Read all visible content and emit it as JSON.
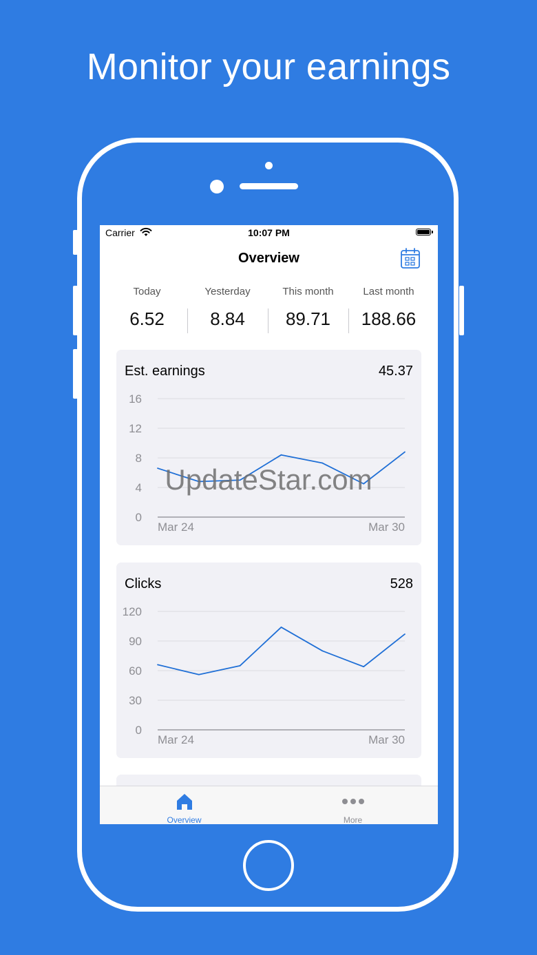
{
  "headline": "Monitor your earnings",
  "status_bar": {
    "carrier": "Carrier",
    "time": "10:07 PM"
  },
  "nav": {
    "title": "Overview"
  },
  "stats": [
    {
      "label": "Today",
      "value": "6.52"
    },
    {
      "label": "Yesterday",
      "value": "8.84"
    },
    {
      "label": "This month",
      "value": "89.71"
    },
    {
      "label": "Last month",
      "value": "188.66"
    }
  ],
  "cards": [
    {
      "title": "Est. earnings",
      "total": "45.37"
    },
    {
      "title": "Clicks",
      "total": "528"
    }
  ],
  "tabs": [
    {
      "label": "Overview",
      "icon": "house-icon",
      "active": true
    },
    {
      "label": "More",
      "icon": "ellipsis-icon",
      "active": false
    }
  ],
  "watermark": "UpdateStar.com",
  "colors": {
    "background": "#2f7ce2",
    "accent": "#2f7ce2",
    "line": "#1f6fd6",
    "inactive_tab": "#8e8e93",
    "card": "#f1f1f6"
  },
  "chart_data": [
    {
      "type": "line",
      "x": [
        "Mar 24",
        "Mar 25",
        "Mar 26",
        "Mar 27",
        "Mar 28",
        "Mar 29",
        "Mar 30"
      ],
      "x_tick_labels": [
        "Mar 24",
        "Mar 30"
      ],
      "values": [
        6.6,
        4.8,
        5.0,
        8.4,
        7.3,
        4.5,
        8.8
      ],
      "yticks": [
        0,
        4,
        8,
        12,
        16
      ],
      "ylim": [
        0,
        16
      ],
      "grid": true
    },
    {
      "type": "line",
      "x": [
        "Mar 24",
        "Mar 25",
        "Mar 26",
        "Mar 27",
        "Mar 28",
        "Mar 29",
        "Mar 30"
      ],
      "x_tick_labels": [
        "Mar 24",
        "Mar 30"
      ],
      "values": [
        66,
        56,
        65,
        104,
        80,
        64,
        97
      ],
      "yticks": [
        0,
        30,
        60,
        90,
        120
      ],
      "ylim": [
        0,
        120
      ],
      "grid": true
    }
  ]
}
